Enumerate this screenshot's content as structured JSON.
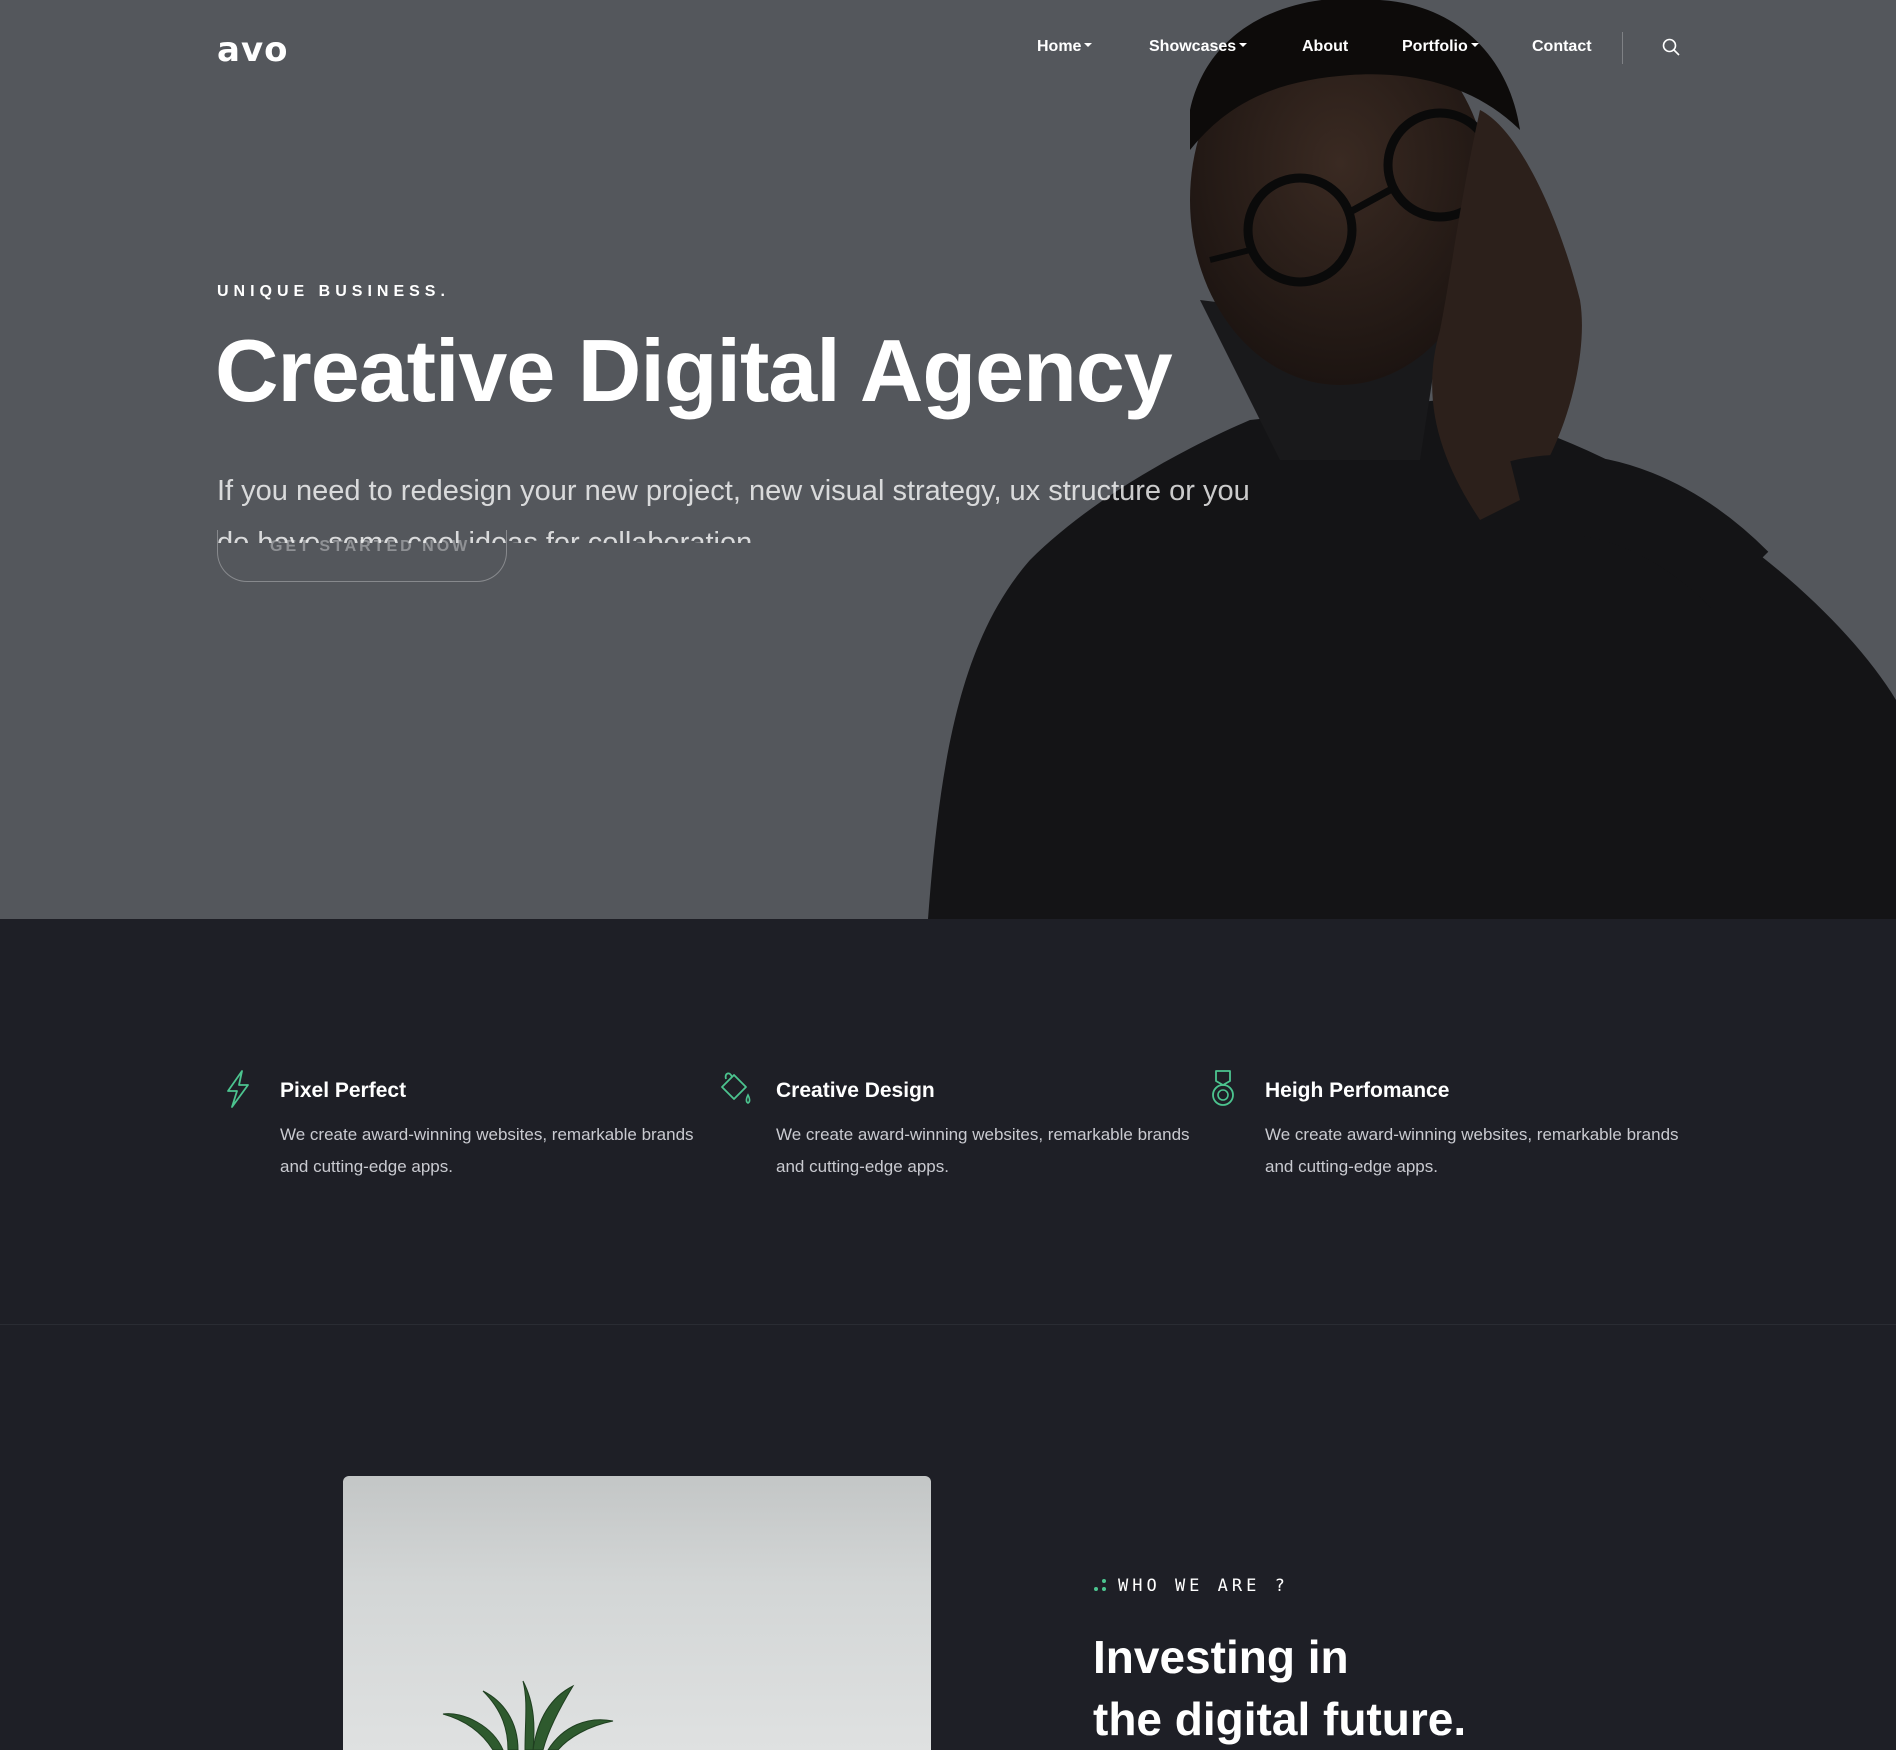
{
  "brand": {
    "logo": "avo"
  },
  "nav": {
    "items": [
      {
        "label": "Home",
        "dropdown": true
      },
      {
        "label": "Showcases",
        "dropdown": true
      },
      {
        "label": "About",
        "dropdown": false
      },
      {
        "label": "Portfolio",
        "dropdown": true
      },
      {
        "label": "Contact",
        "dropdown": false
      }
    ],
    "search_icon": "search-icon"
  },
  "hero": {
    "eyebrow": "UNIQUE BUSINESS.",
    "title": "Creative Digital Agency",
    "subtitle": "If you need to redesign your new project, new visual strategy, ux structure or you do have some cool ideas for collaboration",
    "cta_label": "GET STARTED NOW"
  },
  "features": [
    {
      "icon": "lightning-icon",
      "title": "Pixel Perfect",
      "text": "We create award-winning websites, remarkable brands and cutting-edge apps."
    },
    {
      "icon": "paint-bucket-icon",
      "title": "Creative Design",
      "text": "We create award-winning websites, remarkable brands and cutting-edge apps."
    },
    {
      "icon": "medal-icon",
      "title": "Heigh Perfomance",
      "text": "We create award-winning websites, remarkable brands and cutting-edge apps."
    }
  ],
  "about": {
    "label": "WHO WE ARE ?",
    "title_line1": "Investing in",
    "title_line2": "the digital future."
  },
  "colors": {
    "hero_bg": "#54575c",
    "page_bg": "#1e1f26",
    "accent": "#4cc48f"
  }
}
